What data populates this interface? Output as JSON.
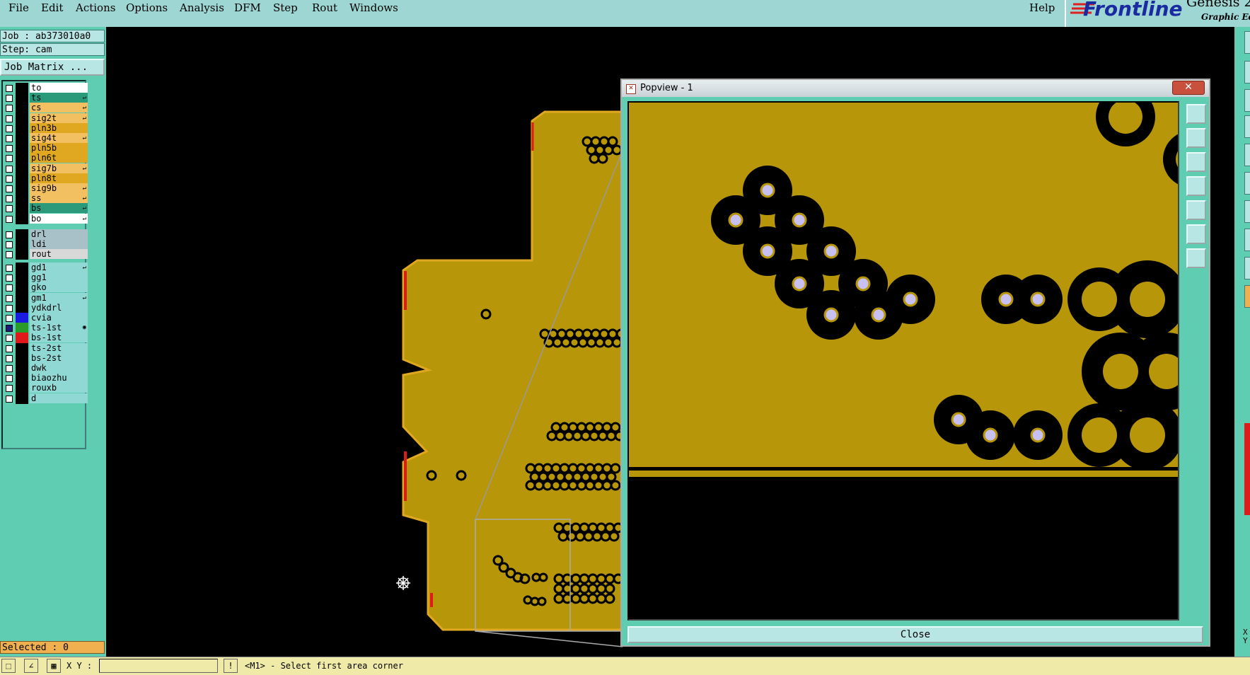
{
  "menu": {
    "items": [
      "File",
      "Edit",
      "Actions",
      "Options",
      "Analysis",
      "DFM",
      "Step",
      "Rout",
      "Windows"
    ],
    "help": "Help"
  },
  "brand": {
    "name": "Frontline",
    "product": "Genesis 2",
    "subtitle": "Graphic Edi"
  },
  "job": {
    "label": "Job : ab373010a0",
    "step": "Step: cam",
    "matrix_button": "Job Matrix ..."
  },
  "layers": [
    {
      "name": "to",
      "color": "#ffffff",
      "swatch": "#000000",
      "mark": ""
    },
    {
      "name": "ts",
      "color": "#2a9a7a",
      "swatch": "#000000",
      "mark": "e"
    },
    {
      "name": "cs",
      "color": "#f2c060",
      "swatch": "#000000",
      "mark": "e"
    },
    {
      "name": "sig2t",
      "color": "#f2c060",
      "swatch": "#000000",
      "mark": "e"
    },
    {
      "name": "pln3b",
      "color": "#e0a820",
      "swatch": "#000000",
      "mark": ""
    },
    {
      "name": "sig4t",
      "color": "#f2c060",
      "swatch": "#000000",
      "mark": "e"
    },
    {
      "name": "pln5b",
      "color": "#e0a820",
      "swatch": "#000000",
      "mark": ""
    },
    {
      "name": "pln6t",
      "color": "#e0a820",
      "swatch": "#000000",
      "mark": ""
    },
    {
      "name": "sig7b",
      "color": "#f2c060",
      "swatch": "#000000",
      "mark": "e"
    },
    {
      "name": "pln8t",
      "color": "#e0a820",
      "swatch": "#000000",
      "mark": ""
    },
    {
      "name": "sig9b",
      "color": "#f2c060",
      "swatch": "#000000",
      "mark": "e"
    },
    {
      "name": "ss",
      "color": "#f2c060",
      "swatch": "#000000",
      "mark": "e"
    },
    {
      "name": "bs",
      "color": "#2a9a7a",
      "swatch": "#000000",
      "mark": "e"
    },
    {
      "name": "bo",
      "color": "#ffffff",
      "swatch": "#000000",
      "mark": "e"
    }
  ],
  "drill_layers": [
    {
      "name": "drl",
      "color": "#a8c0c8"
    },
    {
      "name": "ldi",
      "color": "#a8c0c8"
    },
    {
      "name": "rout",
      "color": "#d8d8d8"
    }
  ],
  "misc_layers": [
    {
      "name": "gd1",
      "color": "#8fd8d4",
      "swatch": "#000000",
      "mark": "e",
      "checked": false
    },
    {
      "name": "gg1",
      "color": "#8fd8d4",
      "swatch": "#000000",
      "mark": "",
      "checked": false
    },
    {
      "name": "gko",
      "color": "#8fd8d4",
      "swatch": "#000000",
      "mark": "",
      "checked": false
    },
    {
      "name": "gm1",
      "color": "#8fd8d4",
      "swatch": "#000000",
      "mark": "e",
      "checked": false
    },
    {
      "name": "ydkdrl",
      "color": "#8fd8d4",
      "swatch": "#000000",
      "mark": "",
      "checked": false
    },
    {
      "name": "cvia",
      "color": "#8fd8d4",
      "swatch": "#1a1ae0",
      "mark": "",
      "checked": false
    },
    {
      "name": "ts-1st",
      "color": "#8fd8d4",
      "swatch": "#2a9a2a",
      "mark": "o",
      "checked": true
    },
    {
      "name": "bs-1st",
      "color": "#8fd8d4",
      "swatch": "#e01a1a",
      "mark": "",
      "checked": false
    },
    {
      "name": "ts-2st",
      "color": "#8fd8d4",
      "swatch": "#000000",
      "mark": "",
      "checked": false
    },
    {
      "name": "bs-2st",
      "color": "#8fd8d4",
      "swatch": "#000000",
      "mark": "",
      "checked": false
    },
    {
      "name": "dwk",
      "color": "#8fd8d4",
      "swatch": "#000000",
      "mark": "",
      "checked": false
    },
    {
      "name": "biaozhu",
      "color": "#8fd8d4",
      "swatch": "#000000",
      "mark": "",
      "checked": false
    },
    {
      "name": "rouxb",
      "color": "#8fd8d4",
      "swatch": "#000000",
      "mark": "",
      "checked": false
    },
    {
      "name": "d",
      "color": "#8fd8d4",
      "swatch": "#000000",
      "mark": "",
      "checked": false
    }
  ],
  "selected": "Selected : 0",
  "popview": {
    "title": "Popview - 1",
    "close_label": "Close"
  },
  "status": {
    "xy_label": "X Y :",
    "xy_value": "",
    "prompt": "<M1> - Select first area corner"
  },
  "right_strip": {
    "xy": "X\nY"
  },
  "colors": {
    "board": "#b8960a",
    "bg": "#000000",
    "panel": "#5fcdb2",
    "menubar": "#9dd6d3"
  }
}
